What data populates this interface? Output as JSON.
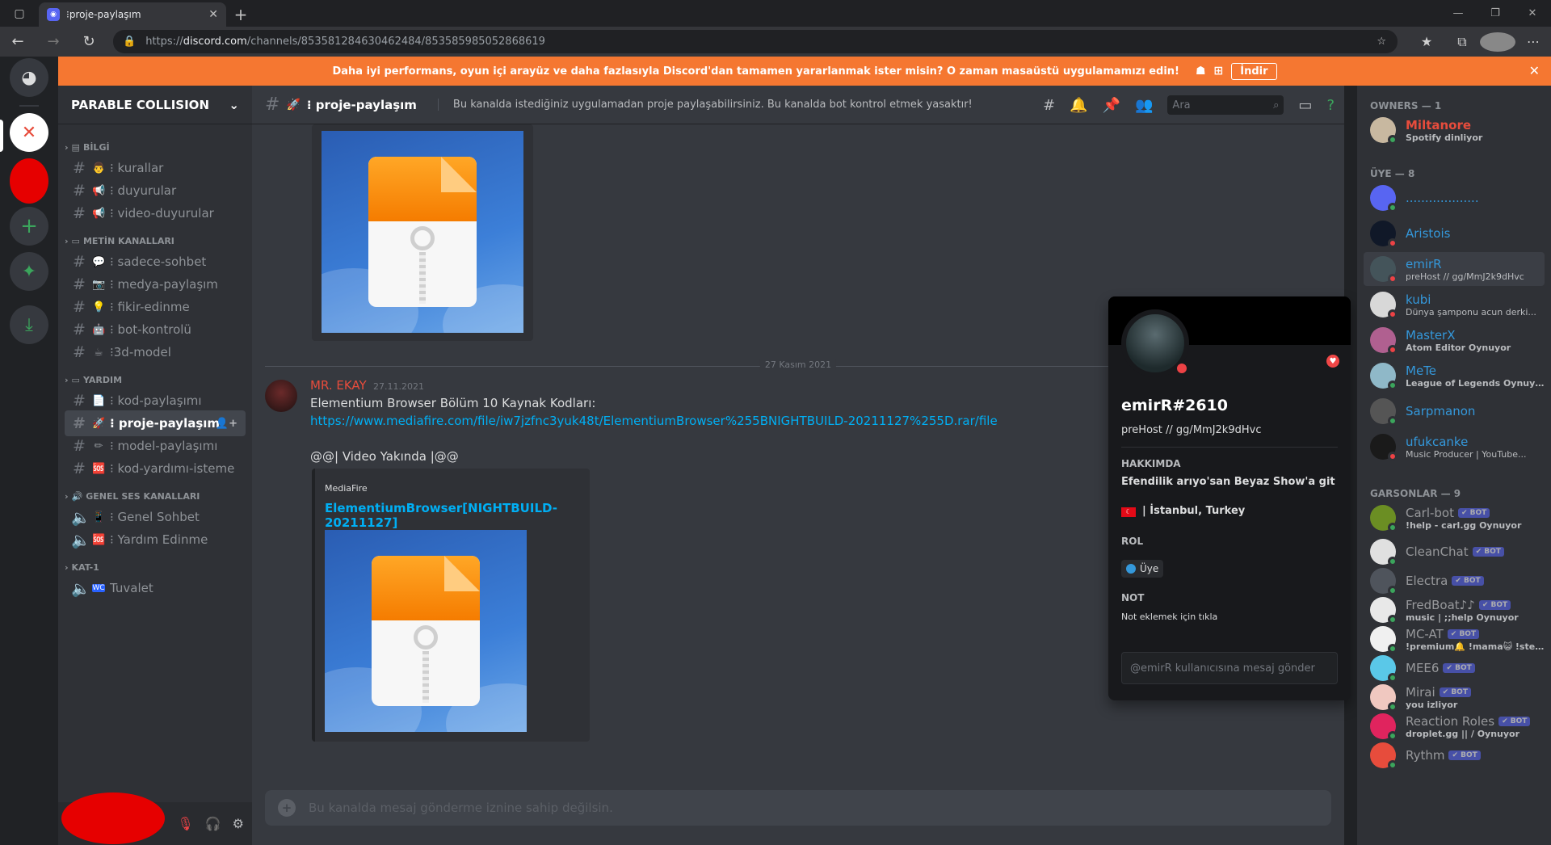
{
  "browser": {
    "tab_title": "⁝proje-paylaşım",
    "url_prefix": "https://",
    "url_host": "discord.com",
    "url_path": "/channels/853581284630462484/853585985052868619"
  },
  "banner": {
    "text": "Daha iyi performans, oyun içi arayüz ve daha fazlasıyla Discord'dan tamamen yararlanmak ister misin? O zaman masaüstü uygulamamızı edin!",
    "download_label": "İndir"
  },
  "server": {
    "name": "PARABLE COLLISION",
    "categories": {
      "bilgi": "BİLGİ",
      "metin": "METİN KANALLARI",
      "yardim": "YARDIM",
      "ses": "GENEL SES KANALLARI",
      "kat": "KAT-1"
    },
    "channels": {
      "kurallar": "⁝ kurallar",
      "duyurular": "⁝ duyurular",
      "video_duyurular": "⁝ video-duyurular",
      "sadece_sohbet": "⁝ sadece-sohbet",
      "medya": "⁝ medya-paylaşım",
      "fikir": "⁝ fikir-edinme",
      "bot_kontrolu": "⁝ bot-kontrolü",
      "model3d": "⁝3d-model",
      "kod": "⁝ kod-paylaşımı",
      "proje": "⁝ proje-paylaşım",
      "model_pay": "⁝ model-paylaşımı",
      "kod_yardim": "⁝ kod-yardımı-isteme",
      "genel_sohbet": "⁝ Genel Sohbet",
      "yardim_edinme": "⁝ Yardım Edinme",
      "tuvalet": "Tuvalet"
    }
  },
  "chat": {
    "channel_name": "⁝ proje-paylaşım",
    "topic": "Bu kanalda istediğiniz uygulamadan proje paylaşabilirsiniz. Bu kanalda bot kontrol etmek yasaktır!",
    "search_placeholder": "Ara",
    "date_divider": "27 Kasım 2021",
    "message": {
      "author": "MR. EKAY",
      "time": "27.11.2021",
      "line1": "Elementium Browser Bölüm 10 Kaynak Kodları:",
      "link": "https://www.mediafire.com/file/iw7jzfnc3yuk48t/ElementiumBrowser%255BNIGHTBUILD-20211127%255D.rar/file",
      "line2": "@@| Video Yakında |@@"
    },
    "embed": {
      "provider": "MediaFire",
      "title": "ElementiumBrowser[NIGHTBUILD-20211127]"
    },
    "input_placeholder": "Bu kanalda mesaj gönderme iznine sahip değilsin."
  },
  "profile": {
    "username": "emirR#2610",
    "status": "preHost // gg/MmJ2k9dHvc",
    "about_header": "HAKKIMDA",
    "about_text": "Efendilik arıyo'san Beyaz Show'a git",
    "location": "|  İstanbul, Turkey",
    "role_header": "ROL",
    "role": "Üye",
    "note_header": "NOT",
    "note_text": "Not eklemek için tıkla",
    "message_placeholder": "@emirR kullanıcısına mesaj gönder"
  },
  "members": {
    "owners_header": "OWNERS — 1",
    "members_header": "ÜYE — 8",
    "bots_header": "GARSONLAR — 9",
    "bot_label": "✔ BOT",
    "list": [
      {
        "name": "Miltanore",
        "activity": "Spotify dinliyor",
        "color": "#e74c3c"
      },
      {
        "name": "...................",
        "activity": "",
        "color": "#3498db"
      },
      {
        "name": "Aristois",
        "activity": "",
        "color": "#3498db"
      },
      {
        "name": "emirR",
        "activity": "preHost // gg/MmJ2k9dHvc",
        "color": "#3498db"
      },
      {
        "name": "kubi",
        "activity": "Dünya şamponu acun derki...",
        "color": "#3498db"
      },
      {
        "name": "MasterX",
        "activity": "Atom Editor Oynuyor",
        "color": "#3498db"
      },
      {
        "name": "MeTe",
        "activity": "League of Legends Oynuyor",
        "color": "#3498db"
      },
      {
        "name": "Sarpmanon",
        "activity": "",
        "color": "#3498db"
      },
      {
        "name": "ufukcanke",
        "activity": "Music Producer | YouTube...",
        "color": "#3498db"
      },
      {
        "name": "Carl-bot",
        "activity": "!help - carl.gg Oynuyor",
        "color": "#8e9297"
      },
      {
        "name": "CleanChat",
        "activity": "",
        "color": "#8e9297"
      },
      {
        "name": "Electra",
        "activity": "",
        "color": "#8e9297"
      },
      {
        "name": "FredBoat♪♪",
        "activity": "music | ;;help Oynuyor",
        "color": "#8e9297"
      },
      {
        "name": "MC-AT",
        "activity": "!premium🔔 !mama😺 !steam...",
        "color": "#8e9297"
      },
      {
        "name": "MEE6",
        "activity": "",
        "color": "#8e9297"
      },
      {
        "name": "Mirai",
        "activity": "you izliyor",
        "color": "#8e9297"
      },
      {
        "name": "Reaction Roles",
        "activity": "droplet.gg || / Oynuyor",
        "color": "#8e9297"
      },
      {
        "name": "Rythm",
        "activity": "",
        "color": "#8e9297"
      }
    ]
  }
}
